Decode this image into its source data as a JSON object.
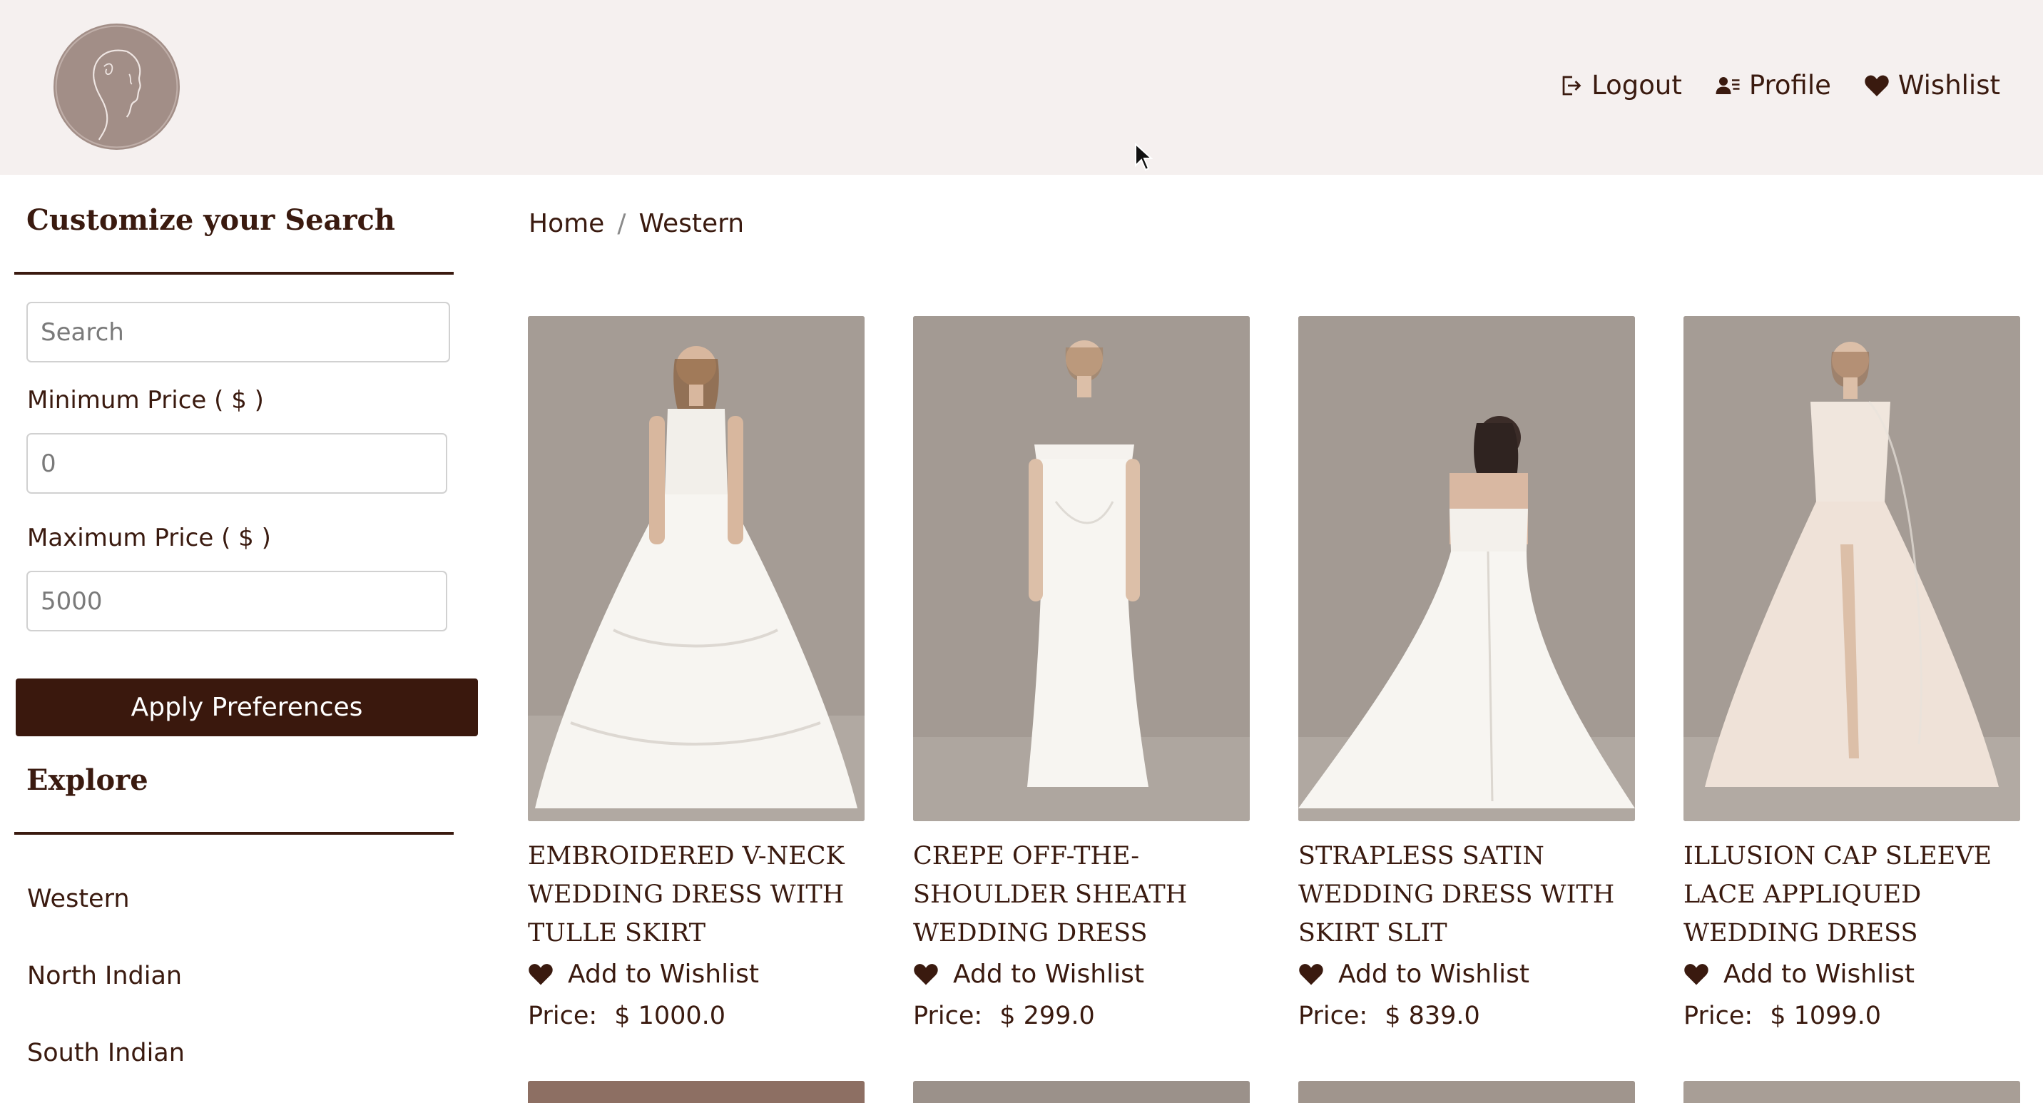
{
  "header": {
    "nav": {
      "logout": "Logout",
      "profile": "Profile",
      "wishlist": "Wishlist"
    }
  },
  "sidebar": {
    "search_heading": "Customize your Search",
    "search_placeholder": "Search",
    "min_price_label": "Minimum Price ( $ )",
    "min_price_value": "0",
    "max_price_label": "Maximum Price ( $ )",
    "max_price_value": "5000",
    "apply_label": "Apply Preferences",
    "explore_heading": "Explore",
    "explore_links": [
      "Western",
      "North Indian",
      "South Indian"
    ]
  },
  "breadcrumb": {
    "home": "Home",
    "separator": "/",
    "current": "Western"
  },
  "products": [
    {
      "title": "EMBROIDERED V-NECK WEDDING DRESS WITH TULLE SKIRT",
      "wishlist_label": "Add to Wishlist",
      "price_label": "Price:",
      "price": "$ 1000.0"
    },
    {
      "title": "CREPE OFF-THE-SHOULDER SHEATH WEDDING DRESS",
      "wishlist_label": "Add to Wishlist",
      "price_label": "Price:",
      "price": "$ 299.0"
    },
    {
      "title": "STRAPLESS SATIN WEDDING DRESS WITH SKIRT SLIT",
      "wishlist_label": "Add to Wishlist",
      "price_label": "Price:",
      "price": "$ 839.0"
    },
    {
      "title": "ILLUSION CAP SLEEVE LACE APPLIQUED WEDDING DRESS",
      "wishlist_label": "Add to Wishlist",
      "price_label": "Price:",
      "price": "$ 1099.0"
    }
  ],
  "colors": {
    "header_bg": "#f5f0ef",
    "brand_dark": "#3a180d",
    "logo_bg": "#a28e87",
    "photo_bg": "#a39a93"
  },
  "icons": {
    "logout": "logout-icon",
    "profile": "profile-icon",
    "wishlist": "heart-icon"
  }
}
